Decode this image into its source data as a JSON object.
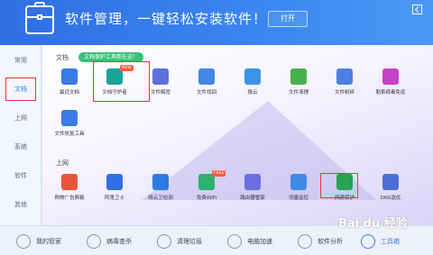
{
  "header": {
    "title": "软件管理，一键轻松安装软件！",
    "open_button": "打开"
  },
  "sidebar": {
    "items": [
      {
        "label": "常用"
      },
      {
        "label": "文档"
      },
      {
        "label": "上网"
      },
      {
        "label": "系统"
      },
      {
        "label": "软件"
      },
      {
        "label": "其他"
      }
    ],
    "active": "文档"
  },
  "sections": {
    "doc": {
      "title": "文档",
      "promo": "文档保护工具新在这！",
      "apps": [
        {
          "label": "最近文档",
          "icon": "recent-docs-icon",
          "color": "#3a7be8"
        },
        {
          "label": "文档守护者",
          "icon": "doc-guardian-icon",
          "color": "#1aa39a",
          "badge": "NEW"
        },
        {
          "label": "文件解密",
          "icon": "file-decrypt-icon",
          "color": "#5f6fdc"
        },
        {
          "label": "文件找回",
          "icon": "file-recover-icon",
          "color": "#4287e8"
        },
        {
          "label": "微云",
          "icon": "weiyun-icon",
          "color": "#3a95e8"
        },
        {
          "label": "文件清理",
          "icon": "file-clean-icon",
          "color": "#48b04f"
        },
        {
          "label": "文件粉碎",
          "icon": "file-shred-icon",
          "color": "#4c7fe3"
        },
        {
          "label": "勒索病毒免疫",
          "icon": "ransomware-immune-icon",
          "color": "#c544c6"
        },
        {
          "label": "文件恢复工具",
          "icon": "file-restore-tool-icon",
          "color": "#3a7be8"
        }
      ]
    },
    "web": {
      "title": "上网",
      "apps": [
        {
          "label": "购物广告屏蔽",
          "icon": "ad-block-icon",
          "color": "#e8563a"
        },
        {
          "label": "阿鬼卫士",
          "icon": "gui-guard-icon",
          "color": "#2f6fe3"
        },
        {
          "label": "晴云卫检测",
          "icon": "cloud-check-icon",
          "color": "#2e7be6"
        },
        {
          "label": "免费WiFi",
          "icon": "free-wifi-icon",
          "color": "#2bb06f",
          "badge": "FREE"
        },
        {
          "label": "路由器管家",
          "icon": "router-icon",
          "color": "#6a6fe0"
        },
        {
          "label": "流量监控",
          "icon": "traffic-monitor-icon",
          "color": "#3f8ae8"
        },
        {
          "label": "网速保护",
          "icon": "net-protect-icon",
          "color": "#27a44f"
        },
        {
          "label": "DNS选优",
          "icon": "dns-icon",
          "color": "#4b6fd8"
        }
      ]
    }
  },
  "bottom_nav": [
    {
      "label": "我的管家",
      "icon": "home-icon"
    },
    {
      "label": "病毒查杀",
      "icon": "virus-scan-icon"
    },
    {
      "label": "清理垃圾",
      "icon": "clean-trash-icon"
    },
    {
      "label": "电脑加速",
      "icon": "speedup-icon"
    },
    {
      "label": "软件分析",
      "icon": "software-analysis-icon"
    },
    {
      "label": "工具箱",
      "icon": "toolbox-icon",
      "active": true
    }
  ],
  "watermark": "Bai du 经验"
}
